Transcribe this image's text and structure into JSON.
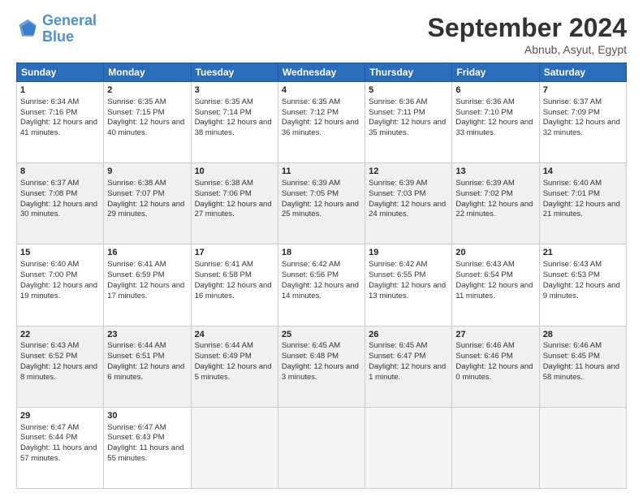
{
  "header": {
    "logo_line1": "General",
    "logo_line2": "Blue",
    "month_title": "September 2024",
    "location": "Abnub, Asyut, Egypt"
  },
  "days_of_week": [
    "Sunday",
    "Monday",
    "Tuesday",
    "Wednesday",
    "Thursday",
    "Friday",
    "Saturday"
  ],
  "weeks": [
    [
      {
        "day": 1,
        "sunrise": "6:34 AM",
        "sunset": "7:16 PM",
        "daylight": "12 hours and 41 minutes."
      },
      {
        "day": 2,
        "sunrise": "6:35 AM",
        "sunset": "7:15 PM",
        "daylight": "12 hours and 40 minutes."
      },
      {
        "day": 3,
        "sunrise": "6:35 AM",
        "sunset": "7:14 PM",
        "daylight": "12 hours and 38 minutes."
      },
      {
        "day": 4,
        "sunrise": "6:35 AM",
        "sunset": "7:12 PM",
        "daylight": "12 hours and 36 minutes."
      },
      {
        "day": 5,
        "sunrise": "6:36 AM",
        "sunset": "7:11 PM",
        "daylight": "12 hours and 35 minutes."
      },
      {
        "day": 6,
        "sunrise": "6:36 AM",
        "sunset": "7:10 PM",
        "daylight": "12 hours and 33 minutes."
      },
      {
        "day": 7,
        "sunrise": "6:37 AM",
        "sunset": "7:09 PM",
        "daylight": "12 hours and 32 minutes."
      }
    ],
    [
      {
        "day": 8,
        "sunrise": "6:37 AM",
        "sunset": "7:08 PM",
        "daylight": "12 hours and 30 minutes."
      },
      {
        "day": 9,
        "sunrise": "6:38 AM",
        "sunset": "7:07 PM",
        "daylight": "12 hours and 29 minutes."
      },
      {
        "day": 10,
        "sunrise": "6:38 AM",
        "sunset": "7:06 PM",
        "daylight": "12 hours and 27 minutes."
      },
      {
        "day": 11,
        "sunrise": "6:39 AM",
        "sunset": "7:05 PM",
        "daylight": "12 hours and 25 minutes."
      },
      {
        "day": 12,
        "sunrise": "6:39 AM",
        "sunset": "7:03 PM",
        "daylight": "12 hours and 24 minutes."
      },
      {
        "day": 13,
        "sunrise": "6:39 AM",
        "sunset": "7:02 PM",
        "daylight": "12 hours and 22 minutes."
      },
      {
        "day": 14,
        "sunrise": "6:40 AM",
        "sunset": "7:01 PM",
        "daylight": "12 hours and 21 minutes."
      }
    ],
    [
      {
        "day": 15,
        "sunrise": "6:40 AM",
        "sunset": "7:00 PM",
        "daylight": "12 hours and 19 minutes."
      },
      {
        "day": 16,
        "sunrise": "6:41 AM",
        "sunset": "6:59 PM",
        "daylight": "12 hours and 17 minutes."
      },
      {
        "day": 17,
        "sunrise": "6:41 AM",
        "sunset": "6:58 PM",
        "daylight": "12 hours and 16 minutes."
      },
      {
        "day": 18,
        "sunrise": "6:42 AM",
        "sunset": "6:56 PM",
        "daylight": "12 hours and 14 minutes."
      },
      {
        "day": 19,
        "sunrise": "6:42 AM",
        "sunset": "6:55 PM",
        "daylight": "12 hours and 13 minutes."
      },
      {
        "day": 20,
        "sunrise": "6:43 AM",
        "sunset": "6:54 PM",
        "daylight": "12 hours and 11 minutes."
      },
      {
        "day": 21,
        "sunrise": "6:43 AM",
        "sunset": "6:53 PM",
        "daylight": "12 hours and 9 minutes."
      }
    ],
    [
      {
        "day": 22,
        "sunrise": "6:43 AM",
        "sunset": "6:52 PM",
        "daylight": "12 hours and 8 minutes."
      },
      {
        "day": 23,
        "sunrise": "6:44 AM",
        "sunset": "6:51 PM",
        "daylight": "12 hours and 6 minutes."
      },
      {
        "day": 24,
        "sunrise": "6:44 AM",
        "sunset": "6:49 PM",
        "daylight": "12 hours and 5 minutes."
      },
      {
        "day": 25,
        "sunrise": "6:45 AM",
        "sunset": "6:48 PM",
        "daylight": "12 hours and 3 minutes."
      },
      {
        "day": 26,
        "sunrise": "6:45 AM",
        "sunset": "6:47 PM",
        "daylight": "12 hours and 1 minute."
      },
      {
        "day": 27,
        "sunrise": "6:46 AM",
        "sunset": "6:46 PM",
        "daylight": "12 hours and 0 minutes."
      },
      {
        "day": 28,
        "sunrise": "6:46 AM",
        "sunset": "6:45 PM",
        "daylight": "11 hours and 58 minutes."
      }
    ],
    [
      {
        "day": 29,
        "sunrise": "6:47 AM",
        "sunset": "6:44 PM",
        "daylight": "11 hours and 57 minutes."
      },
      {
        "day": 30,
        "sunrise": "6:47 AM",
        "sunset": "6:43 PM",
        "daylight": "11 hours and 55 minutes."
      },
      null,
      null,
      null,
      null,
      null
    ]
  ]
}
